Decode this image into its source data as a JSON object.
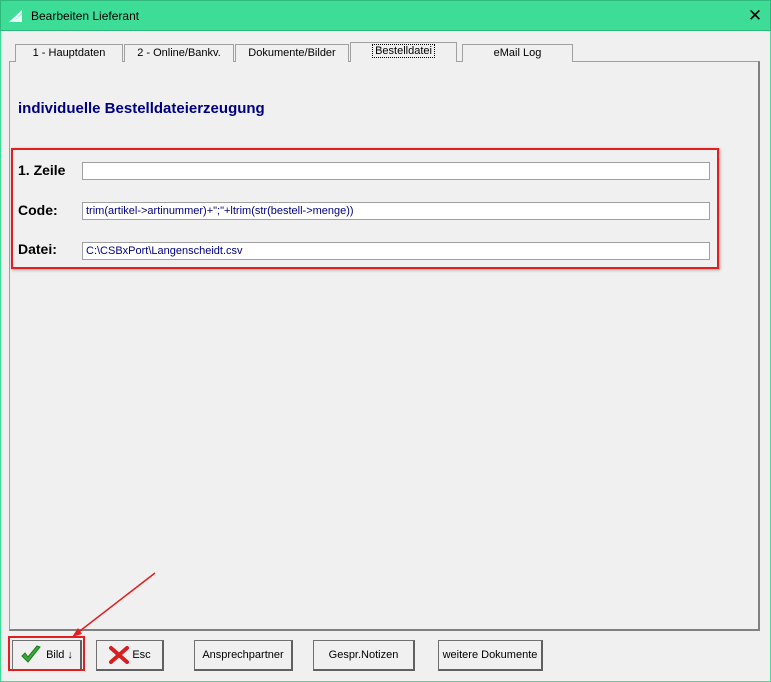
{
  "window": {
    "title": "Bearbeiten Lieferant",
    "close": "✕"
  },
  "tabs": [
    {
      "label": "1 - Hauptdaten",
      "active": false
    },
    {
      "label": "2 - Online/Bankv.",
      "active": false
    },
    {
      "label": "Dokumente/Bilder",
      "active": false
    },
    {
      "label": "Bestelldatei",
      "active": true
    },
    {
      "label": "eMail Log",
      "active": false
    }
  ],
  "heading": "individuelle Bestelldateierzeugung",
  "fields": {
    "zeile": {
      "label": "1. Zeile",
      "value": ""
    },
    "code": {
      "label": "Code:",
      "value": "trim(artikel->artinummer)+\";\"+ltrim(str(bestell->menge))"
    },
    "datei": {
      "label": "Datei:",
      "value": "C:\\CSBxPort\\Langenscheidt.csv"
    }
  },
  "buttons": {
    "bild": "Bild",
    "esc": "Esc",
    "ansprechpartner": "Ansprechpartner",
    "notizen": "Gespr.Notizen",
    "weitere": "weitere Dokumente"
  },
  "colors": {
    "titlebar": "#3ddc97",
    "heading": "#000080",
    "highlight": "#e02020"
  }
}
